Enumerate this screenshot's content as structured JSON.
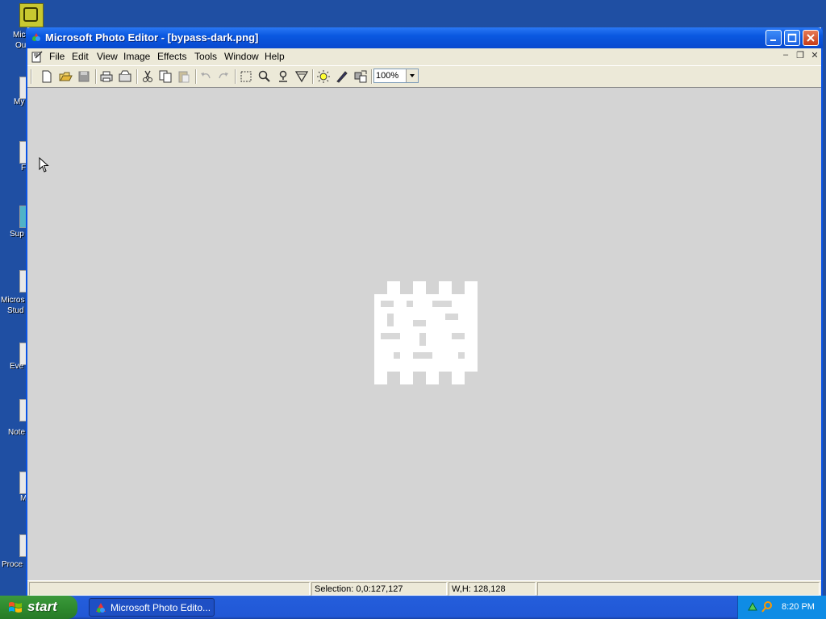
{
  "desktop": {
    "labels": [
      {
        "text": "Mic",
        "text2": "Ou"
      },
      {
        "text": "My"
      },
      {
        "text": "F"
      },
      {
        "text": "Sup"
      },
      {
        "text": "Micros",
        "text2": "Stud"
      },
      {
        "text": "Eve"
      },
      {
        "text": "Note"
      },
      {
        "text": "M"
      },
      {
        "text": "Proce"
      }
    ]
  },
  "window": {
    "title": "Microsoft Photo Editor - [bypass-dark.png]",
    "menu": [
      "File",
      "Edit",
      "View",
      "Image",
      "Effects",
      "Tools",
      "Window",
      "Help"
    ],
    "mdi": {
      "minimize": "–",
      "restore": "❐",
      "close": "✕"
    },
    "zoom": "100%",
    "status": {
      "selection": "Selection: 0,0:127,127",
      "size": "W,H: 128,128"
    }
  },
  "taskbar": {
    "start": "start",
    "task": "Microsoft Photo Edito...",
    "clock": "8:20 PM"
  }
}
